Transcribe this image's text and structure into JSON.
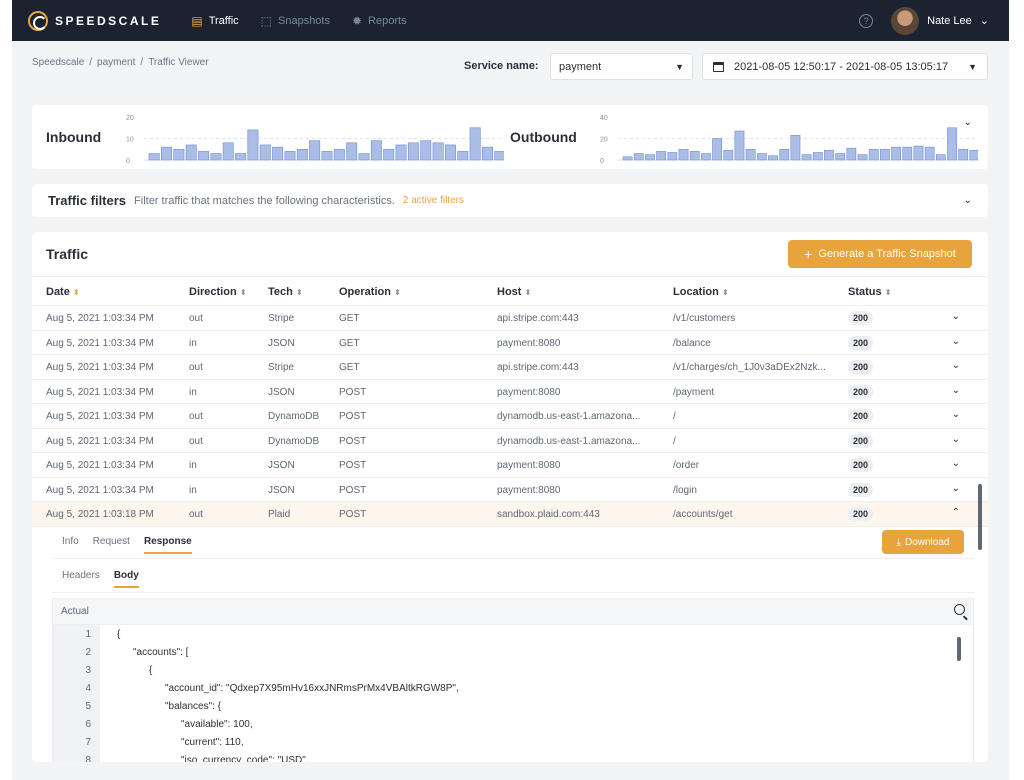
{
  "nav": {
    "brand": "SPEEDSCALE",
    "items": [
      {
        "label": "Traffic",
        "icon": "traffic-icon",
        "active": true
      },
      {
        "label": "Snapshots",
        "icon": "snapshots-icon",
        "active": false
      },
      {
        "label": "Reports",
        "icon": "reports-icon",
        "active": false
      }
    ],
    "user_name": "Nate Lee"
  },
  "breadcrumb": [
    "Speedscale",
    "payment",
    "Traffic Viewer"
  ],
  "service": {
    "label": "Service name:",
    "value": "payment"
  },
  "date_range": "2021-08-05 12:50:17 - 2021-08-05 13:05:17",
  "sparklines": {
    "inbound": {
      "title": "Inbound",
      "ticks": [
        "20",
        "10",
        "0"
      ],
      "ymax": 20,
      "values": [
        3,
        6,
        5,
        7,
        4,
        3,
        8,
        3,
        14,
        7,
        6,
        4,
        5,
        9,
        4,
        5,
        8,
        3,
        9,
        5,
        7,
        8,
        9,
        8,
        7,
        4,
        15,
        6,
        4
      ]
    },
    "outbound": {
      "title": "Outbound",
      "ticks": [
        "40",
        "20",
        "0"
      ],
      "ymax": 40,
      "values": [
        3,
        6,
        5,
        8,
        7,
        10,
        8,
        6,
        20,
        9,
        27,
        10,
        6,
        4,
        10,
        23,
        5,
        7,
        9,
        6,
        11,
        5,
        10,
        10,
        12,
        12,
        13,
        12,
        5,
        30,
        10,
        9
      ]
    }
  },
  "filters": {
    "title": "Traffic filters",
    "description": "Filter traffic that matches the following characteristics.",
    "active": "2 active filters"
  },
  "traffic": {
    "title": "Traffic",
    "generate_label": "Generate a Traffic Snapshot",
    "columns": [
      "Date",
      "Direction",
      "Tech",
      "Operation",
      "Host",
      "Location",
      "Status"
    ],
    "rows": [
      {
        "date": "Aug 5, 2021 1:03:34 PM",
        "direction": "out",
        "tech": "Stripe",
        "operation": "GET",
        "host": "api.stripe.com:443",
        "location": "/v1/customers",
        "status": "200"
      },
      {
        "date": "Aug 5, 2021 1:03:34 PM",
        "direction": "in",
        "tech": "JSON",
        "operation": "GET",
        "host": "payment:8080",
        "location": "/balance",
        "status": "200"
      },
      {
        "date": "Aug 5, 2021 1:03:34 PM",
        "direction": "out",
        "tech": "Stripe",
        "operation": "GET",
        "host": "api.stripe.com:443",
        "location": "/v1/charges/ch_1J0v3aDEx2Nzk...",
        "status": "200"
      },
      {
        "date": "Aug 5, 2021 1:03:34 PM",
        "direction": "in",
        "tech": "JSON",
        "operation": "POST",
        "host": "payment:8080",
        "location": "/payment",
        "status": "200"
      },
      {
        "date": "Aug 5, 2021 1:03:34 PM",
        "direction": "out",
        "tech": "DynamoDB",
        "operation": "POST",
        "host": "dynamodb.us-east-1.amazona...",
        "location": "/",
        "status": "200"
      },
      {
        "date": "Aug 5, 2021 1:03:34 PM",
        "direction": "out",
        "tech": "DynamoDB",
        "operation": "POST",
        "host": "dynamodb.us-east-1.amazona...",
        "location": "/",
        "status": "200"
      },
      {
        "date": "Aug 5, 2021 1:03:34 PM",
        "direction": "in",
        "tech": "JSON",
        "operation": "POST",
        "host": "payment:8080",
        "location": "/order",
        "status": "200"
      },
      {
        "date": "Aug 5, 2021 1:03:34 PM",
        "direction": "in",
        "tech": "JSON",
        "operation": "POST",
        "host": "payment:8080",
        "location": "/login",
        "status": "200"
      },
      {
        "date": "Aug 5, 2021 1:03:18 PM",
        "direction": "out",
        "tech": "Plaid",
        "operation": "POST",
        "host": "sandbox.plaid.com:443",
        "location": "/accounts/get",
        "status": "200"
      }
    ]
  },
  "detail": {
    "tabs": [
      "Info",
      "Request",
      "Response"
    ],
    "active_tab": "Response",
    "subtabs": [
      "Headers",
      "Body"
    ],
    "active_subtab": "Body",
    "download_label": "Download",
    "editor_title": "Actual",
    "lines": [
      {
        "n": "1",
        "indent": 0,
        "text": "{"
      },
      {
        "n": "2",
        "indent": 1,
        "text": "\"accounts\": ["
      },
      {
        "n": "3",
        "indent": 2,
        "text": "{"
      },
      {
        "n": "4",
        "indent": 3,
        "text": "\"account_id\": \"Qdxep7X95mHv16xxJNRmsPrMx4VBAltkRGW8P\","
      },
      {
        "n": "5",
        "indent": 3,
        "text": "\"balances\": {"
      },
      {
        "n": "6",
        "indent": 4,
        "text": "\"available\": 100,"
      },
      {
        "n": "7",
        "indent": 4,
        "text": "\"current\": 110,"
      },
      {
        "n": "8",
        "indent": 4,
        "text": "\"iso_currency_code\": \"USD\","
      }
    ]
  },
  "colors": {
    "accent": "#e8a33d",
    "nav_bg": "#1b2331",
    "bar_fill": "#a9bde6",
    "bar_stroke": "#6f8fd0"
  }
}
